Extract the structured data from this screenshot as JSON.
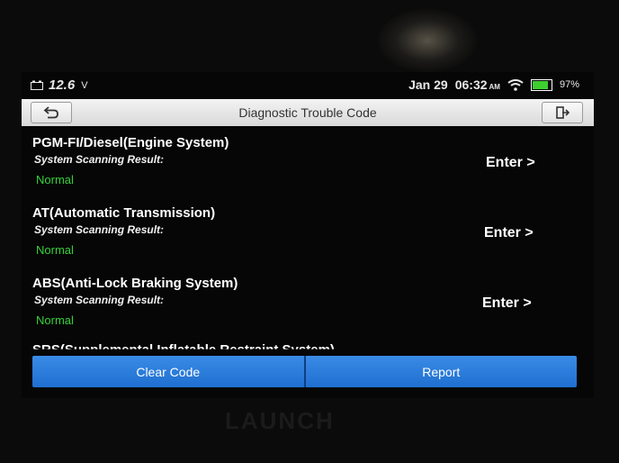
{
  "status": {
    "voltage": "12.6",
    "voltage_unit": "V",
    "date": "Jan 29",
    "time": "06:32",
    "ampm": "AM",
    "battery_percent": "97%",
    "battery_level": 0.97,
    "battery_color": "#3ccf2e"
  },
  "header": {
    "title": "Diagnostic Trouble Code",
    "back_icon": "back-arrow-icon",
    "exit_icon": "exit-icon"
  },
  "systems": [
    {
      "name": "PGM-FI/Diesel(Engine System)",
      "scan_label": "System Scanning Result:",
      "result": "Normal",
      "action": "Enter >"
    },
    {
      "name": "AT(Automatic Transmission)",
      "scan_label": "System Scanning Result:",
      "result": "Normal",
      "action": "Enter >"
    },
    {
      "name": "ABS(Anti-Lock Braking System)",
      "scan_label": "System Scanning Result:",
      "result": "Normal",
      "action": "Enter >"
    }
  ],
  "partial_system": "SRS(Supplemental Inflatable Restraint System)",
  "buttons": {
    "clear": "Clear Code",
    "report": "Report"
  },
  "colors": {
    "accent": "#2a7de1",
    "normal": "#37d13a"
  },
  "brand": "LAUNCH"
}
